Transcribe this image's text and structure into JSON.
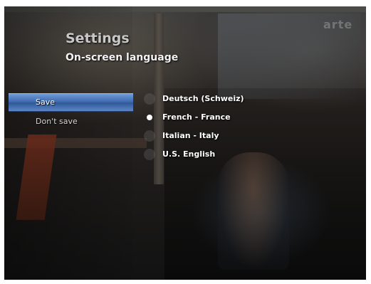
{
  "header": {
    "title": "Settings",
    "subtitle": "On-screen language",
    "channel_logo": "arte"
  },
  "menu": {
    "items": [
      {
        "label": "Save",
        "selected": true
      },
      {
        "label": "Don't save",
        "selected": false
      }
    ]
  },
  "languages": {
    "selected": "French - France",
    "items": [
      {
        "label": "Deutsch (Schweiz)",
        "checked": false
      },
      {
        "label": "French - France",
        "checked": true
      },
      {
        "label": "Italian - Italy",
        "checked": false
      },
      {
        "label": "U.S. English",
        "checked": false
      }
    ]
  },
  "colors": {
    "selection_blue": "#3d68ad",
    "text_white": "#ffffff",
    "title_gray": "#c8c8c8"
  }
}
